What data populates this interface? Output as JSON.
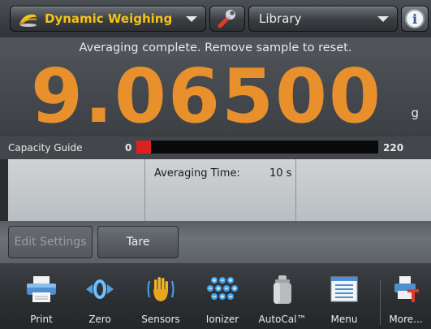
{
  "topbar": {
    "app_name": "Dynamic Weighing",
    "app_icon": "dynamic-weighing-icon",
    "library_label": "Library",
    "wrench_icon": "wrench-icon",
    "info_icon": "info-icon",
    "info_glyph": "i"
  },
  "status_message": "Averaging complete.  Remove sample to reset.",
  "reading": {
    "value": "9.06500",
    "unit": "g"
  },
  "capacity": {
    "label": "Capacity Guide",
    "min": "0",
    "max": "220",
    "fill_fraction": 0.06
  },
  "info": {
    "averaging_time_label": "Averaging Time:",
    "averaging_time_value": "10 s"
  },
  "buttons": {
    "edit_settings": "Edit Settings",
    "tare": "Tare"
  },
  "toolbar": {
    "items": [
      {
        "label": "Print",
        "icon": "printer-icon"
      },
      {
        "label": "Zero",
        "icon": "zero-icon"
      },
      {
        "label": "Sensors",
        "icon": "hand-sensor-icon"
      },
      {
        "label": "Ionizer",
        "icon": "ionizer-icon"
      },
      {
        "label": "AutoCal™",
        "icon": "calibration-weight-icon"
      },
      {
        "label": "Menu",
        "icon": "menu-list-icon"
      },
      {
        "label": "More...",
        "icon": "more-icon"
      }
    ]
  },
  "colors": {
    "accent": "#f5c318",
    "reading": "#e8902c",
    "capacity_fill": "#dd2020"
  }
}
